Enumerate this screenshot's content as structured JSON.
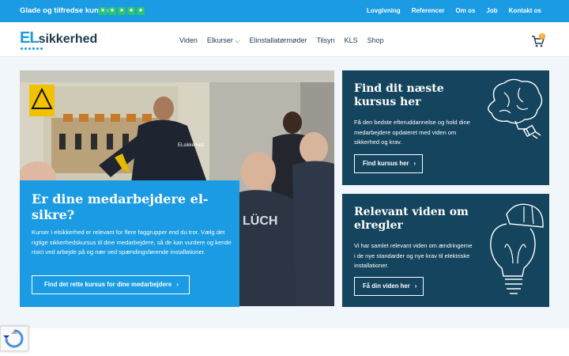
{
  "topbar": {
    "slogan": "Glade og tilfredse kunder",
    "star_color": "#28c76f",
    "star_count": 5,
    "links": [
      "Lovgivning",
      "Referencer",
      "Om os",
      "Job",
      "Kontakt os"
    ]
  },
  "header": {
    "logo_el": "EL",
    "logo_rest": "sikkerhed",
    "nav": [
      "Viden",
      "Elkurser",
      "Elinstallatørmøder",
      "Tilsyn",
      "KLS",
      "Shop"
    ],
    "cart_count": "0"
  },
  "hero": {
    "title": "Er dine medarbejdere el-sikre?",
    "text": "Kurser i elsikkerhed er relevant for flere faggrupper end du tror. Vælg det rigtige sikkerhedskursus til dine medarbejdere, så de kan vurdere og kende risici ved arbejde på og nær ved spændingsførende installationer.",
    "button": "Find det rette kursus for dine medarbejdere",
    "photo_text_jacket": "ELsikkerhed",
    "photo_text_back": "LÜCH"
  },
  "cards": [
    {
      "title": "Find dit næste kursus her",
      "text": "Få den bedste efteruddannelse og hold dine medarbejdere opdateret med viden om sikkerhed og krav.",
      "button": "Find kursus her",
      "icon": "brain-plug-icon"
    },
    {
      "title": "Relevant viden om elregler",
      "text": "Vi har samlet relevant viden om ændringerne i de nye standarder og nye krav til elektriske installationer.",
      "button": "Få din viden her",
      "icon": "lightbulb-helmet-icon"
    }
  ],
  "colors": {
    "primary_blue": "#1a9be3",
    "dark_teal": "#14445e",
    "text_dark": "#1d3b4f",
    "badge": "#f5a623"
  }
}
